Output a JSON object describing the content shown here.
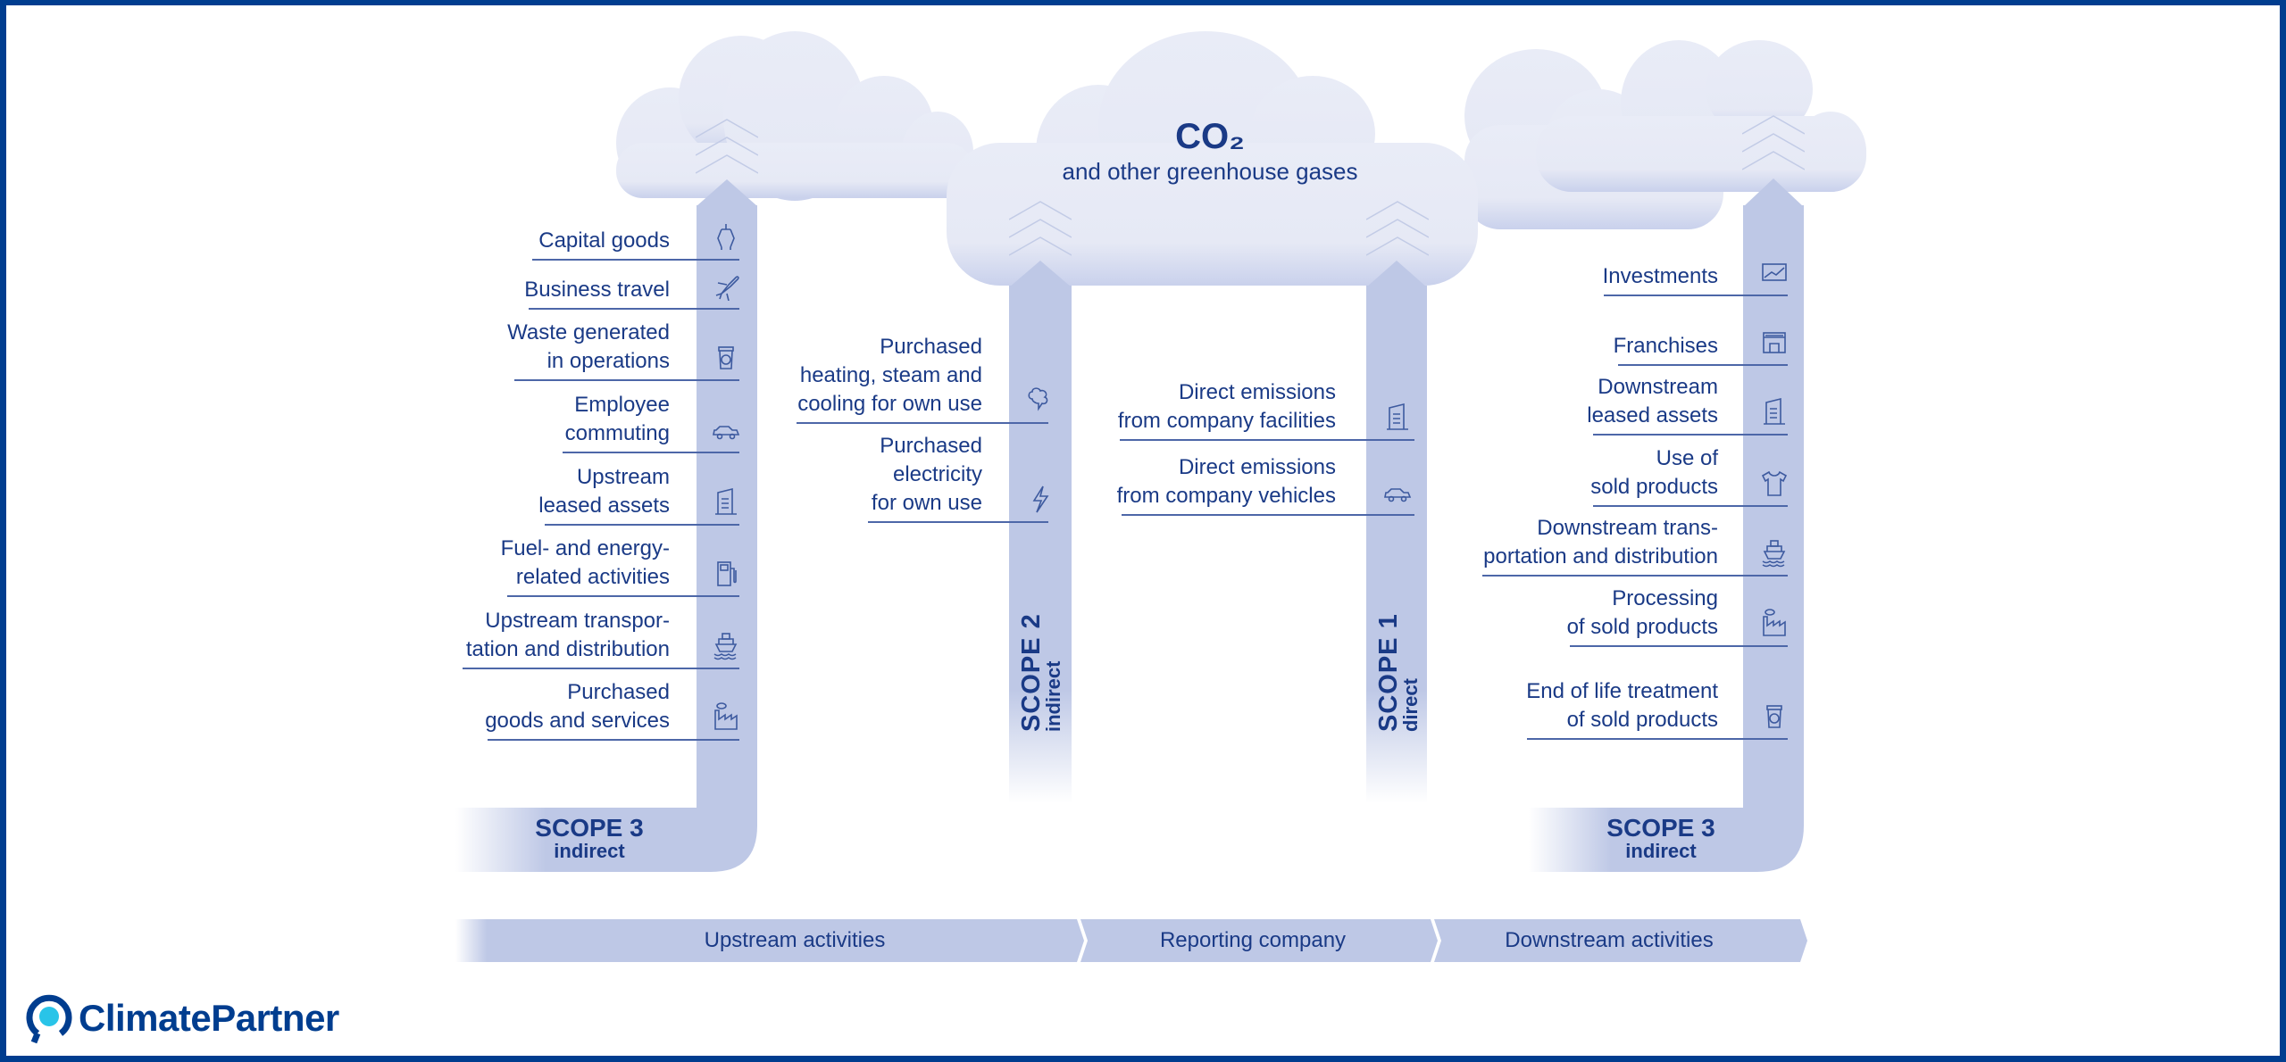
{
  "header": {
    "title": "CO₂",
    "subtitle": "and other greenhouse gases"
  },
  "scopes": {
    "scope3_upstream": {
      "title": "SCOPE 3",
      "subtitle": "indirect"
    },
    "scope2": {
      "title": "SCOPE 2",
      "subtitle": "indirect"
    },
    "scope1": {
      "title": "SCOPE 1",
      "subtitle": "direct"
    },
    "scope3_downstream": {
      "title": "SCOPE 3",
      "subtitle": "indirect"
    }
  },
  "upstream_items": [
    {
      "lines": [
        "Capital goods"
      ],
      "icon": "robot-arm-icon"
    },
    {
      "lines": [
        "Business travel"
      ],
      "icon": "airplane-icon"
    },
    {
      "lines": [
        "Waste generated",
        "in operations"
      ],
      "icon": "recycle-bin-icon"
    },
    {
      "lines": [
        "Employee",
        "commuting"
      ],
      "icon": "car-icon"
    },
    {
      "lines": [
        "Upstream",
        "leased assets"
      ],
      "icon": "building-icon"
    },
    {
      "lines": [
        "Fuel- and energy-",
        "related activities"
      ],
      "icon": "fuel-pump-icon"
    },
    {
      "lines": [
        "Upstream transpor-",
        "tation and distribution"
      ],
      "icon": "ship-icon"
    },
    {
      "lines": [
        "Purchased",
        "goods and services"
      ],
      "icon": "factory-icon"
    }
  ],
  "scope2_items": [
    {
      "lines": [
        "Purchased",
        "heating, steam and",
        "cooling for own use"
      ],
      "icon": "steam-cloud-icon"
    },
    {
      "lines": [
        "Purchased",
        "electricity",
        "for own use"
      ],
      "icon": "lightning-icon"
    }
  ],
  "scope1_items": [
    {
      "lines": [
        "Direct emissions",
        "from company facilities"
      ],
      "icon": "building-icon"
    },
    {
      "lines": [
        "Direct emissions",
        "from company vehicles"
      ],
      "icon": "car-icon"
    }
  ],
  "downstream_items": [
    {
      "lines": [
        "Investments"
      ],
      "icon": "chart-icon"
    },
    {
      "lines": [
        "Franchises"
      ],
      "icon": "storefront-icon"
    },
    {
      "lines": [
        "Downstream",
        "leased assets"
      ],
      "icon": "building-icon"
    },
    {
      "lines": [
        "Use of",
        "sold products"
      ],
      "icon": "tshirt-icon"
    },
    {
      "lines": [
        "Downstream trans-",
        "portation and distribution"
      ],
      "icon": "ship-icon"
    },
    {
      "lines": [
        "Processing",
        "of sold products"
      ],
      "icon": "factory-icon"
    },
    {
      "lines": [
        "End of life treatment",
        "of sold products"
      ],
      "icon": "recycle-bin-icon"
    }
  ],
  "value_chain": {
    "upstream": "Upstream activities",
    "reporting": "Reporting company",
    "downstream": "Downstream activities"
  },
  "brand": {
    "name": "ClimatePartner",
    "primary_color": "#003d8f",
    "accent_color": "#29c4e8",
    "bar_color": "#bec8e6",
    "cloud_color": "#e8ebf6"
  }
}
